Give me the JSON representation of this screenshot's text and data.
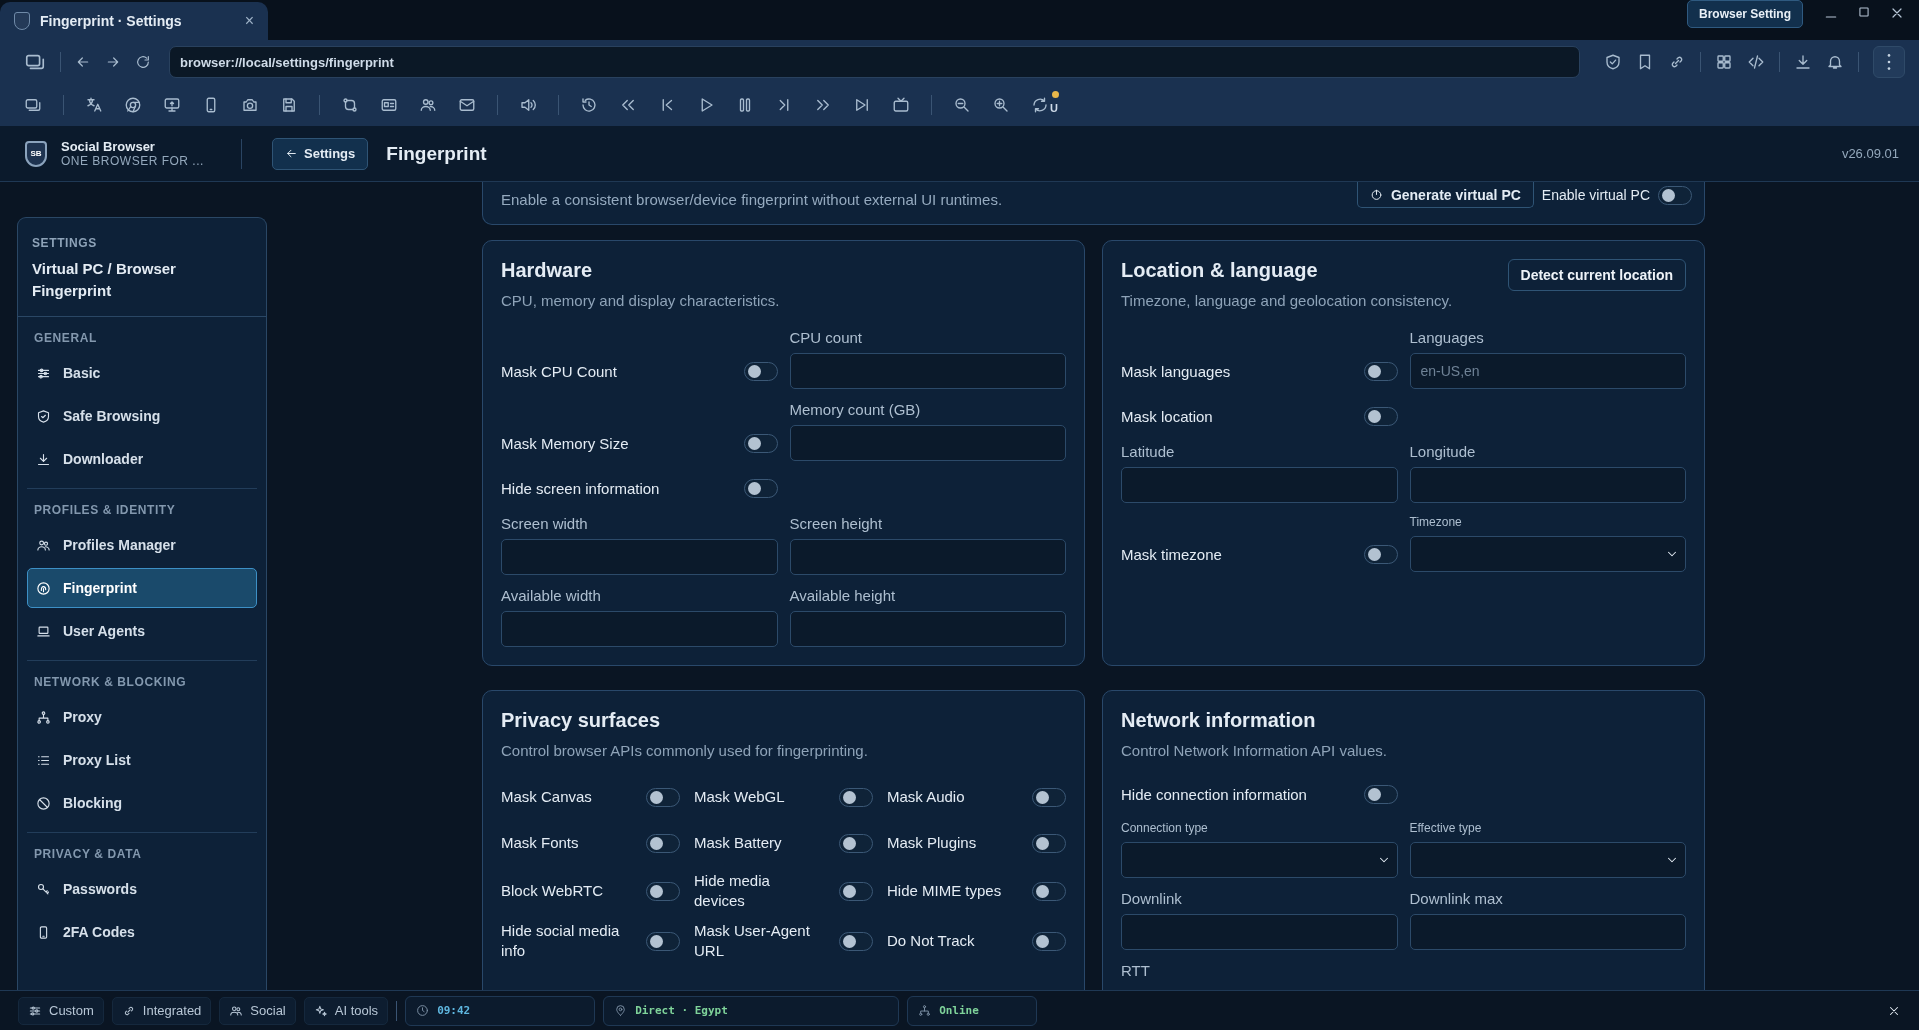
{
  "tab": {
    "title": "Fingerprint · Settings",
    "close": "×"
  },
  "window_badge": "Browser Setting",
  "address": "browser://local/settings/fingerprint",
  "toolbar_badge": "U",
  "header": {
    "logo_text": "SB",
    "app_name": "Social Browser",
    "tagline": "ONE BROWSER FOR ...",
    "back": "Settings",
    "title": "Fingerprint",
    "version": "v26.09.01"
  },
  "sidebar": {
    "eyebrow": "SETTINGS",
    "title": "Virtual PC / Browser Fingerprint",
    "groups": [
      {
        "label": "GENERAL",
        "items": [
          {
            "label": "Basic",
            "selected": false
          },
          {
            "label": "Safe Browsing",
            "selected": false
          },
          {
            "label": "Downloader",
            "selected": false
          }
        ]
      },
      {
        "label": "PROFILES & IDENTITY",
        "items": [
          {
            "label": "Profiles Manager",
            "selected": false
          },
          {
            "label": "Fingerprint",
            "selected": true
          },
          {
            "label": "User Agents",
            "selected": false
          }
        ]
      },
      {
        "label": "NETWORK & BLOCKING",
        "items": [
          {
            "label": "Proxy",
            "selected": false
          },
          {
            "label": "Proxy List",
            "selected": false
          },
          {
            "label": "Blocking",
            "selected": false
          }
        ]
      },
      {
        "label": "PRIVACY & DATA",
        "items": [
          {
            "label": "Passwords",
            "selected": false
          },
          {
            "label": "2FA Codes",
            "selected": false
          }
        ]
      }
    ]
  },
  "virtual_pc": {
    "description": "Enable a consistent browser/device fingerprint without external UI runtimes.",
    "generate_button": "Generate virtual PC",
    "enable_label": "Enable virtual PC",
    "enable_on": false
  },
  "hardware": {
    "title": "Hardware",
    "description": "CPU, memory and display characteristics.",
    "rows": [
      {
        "kind": "toggle_field",
        "label": "Mask CPU Count",
        "on": false,
        "field": {
          "kind": "input",
          "label": "CPU count"
        }
      },
      {
        "kind": "toggle_field",
        "label": "Mask Memory Size",
        "on": false,
        "field": {
          "kind": "input",
          "label": "Memory count (GB)"
        }
      },
      {
        "kind": "toggle",
        "label": "Hide screen information",
        "on": false
      },
      {
        "kind": "fields",
        "fields": [
          {
            "kind": "input",
            "label": "Screen width"
          },
          {
            "kind": "input",
            "label": "Screen height"
          }
        ]
      },
      {
        "kind": "fields",
        "fields": [
          {
            "kind": "input",
            "label": "Available width"
          },
          {
            "kind": "input",
            "label": "Available height"
          }
        ]
      }
    ]
  },
  "location": {
    "title": "Location & language",
    "description": "Timezone, language and geolocation consistency.",
    "button": "Detect current location",
    "rows": [
      {
        "kind": "toggle_field",
        "label": "Mask languages",
        "on": false,
        "field": {
          "kind": "input",
          "label": "Languages",
          "placeholder": "en-US,en"
        }
      },
      {
        "kind": "toggle",
        "label": "Mask location",
        "on": false
      },
      {
        "kind": "fields",
        "fields": [
          {
            "kind": "input",
            "label": "Latitude"
          },
          {
            "kind": "input",
            "label": "Longitude"
          }
        ]
      },
      {
        "kind": "toggle_field",
        "label": "Mask timezone",
        "on": false,
        "field": {
          "kind": "select",
          "label": "Timezone"
        }
      }
    ]
  },
  "privacy": {
    "title": "Privacy surfaces",
    "description": "Control browser APIs commonly used for fingerprinting.",
    "toggles": [
      {
        "label": "Mask Canvas",
        "on": false
      },
      {
        "label": "Mask WebGL",
        "on": false
      },
      {
        "label": "Mask Audio",
        "on": false
      },
      {
        "label": "Mask Fonts",
        "on": false
      },
      {
        "label": "Mask Battery",
        "on": false
      },
      {
        "label": "Mask Plugins",
        "on": false
      },
      {
        "label": "Block WebRTC",
        "on": false
      },
      {
        "label": "Hide media devices",
        "on": false
      },
      {
        "label": "Hide MIME types",
        "on": false
      },
      {
        "label": "Hide social media info",
        "on": false
      },
      {
        "label": "Mask User-Agent URL",
        "on": false
      },
      {
        "label": "Do Not Track",
        "on": false
      }
    ]
  },
  "network": {
    "title": "Network information",
    "description": "Control Network Information API values.",
    "rows": [
      {
        "kind": "toggle",
        "label": "Hide connection information",
        "on": false
      },
      {
        "kind": "fields",
        "fields": [
          {
            "kind": "select",
            "label": "Connection type"
          },
          {
            "kind": "select",
            "label": "Effective type"
          }
        ]
      },
      {
        "kind": "fields",
        "fields": [
          {
            "kind": "input",
            "label": "Downlink"
          },
          {
            "kind": "input",
            "label": "Downlink max"
          }
        ]
      },
      {
        "kind": "label",
        "label": "RTT"
      }
    ]
  },
  "status_bar": {
    "modes": [
      "Custom",
      "Integrated",
      "Social",
      "AI tools"
    ],
    "clock": "09:42",
    "route": "Direct · Egypt",
    "connection": "Online"
  }
}
